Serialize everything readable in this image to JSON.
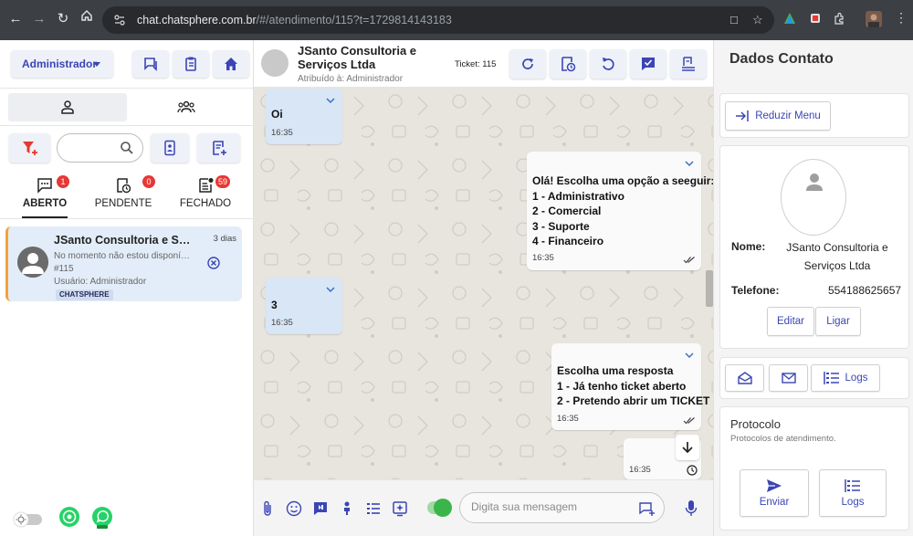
{
  "browser": {
    "url_host": "chat.chatsphere.com.br",
    "url_path": "/#/atendimento/115?t=1729814143183"
  },
  "left": {
    "role_label": "Administrador",
    "status_tabs": [
      {
        "label": "ABERTO",
        "badge": "1"
      },
      {
        "label": "PENDENTE",
        "badge": "0"
      },
      {
        "label": "FECHADO",
        "badge": "59"
      }
    ],
    "ticket": {
      "name": "JSanto Consultoria e Ser...",
      "time": "3 dias",
      "last_message": "No momento não estou disponív...",
      "number": "#115",
      "user": "Usuário: Administrador",
      "tag": "CHATSPHERE"
    }
  },
  "chat": {
    "title": "JSanto Consultoria e Serviços Ltda",
    "assigned": "Atribuído à: Administrador",
    "ticket_label": "Ticket: 115",
    "messages": [
      {
        "dir": "in",
        "text": "Oi",
        "time": "16:35"
      },
      {
        "dir": "out",
        "text": "Olá! Escolha uma opção a seeguir:\n1 - Administrativo\n2 - Comercial\n3 - Suporte\n4 - Financeiro",
        "time": "16:35"
      },
      {
        "dir": "in",
        "text": "3",
        "time": "16:35"
      },
      {
        "dir": "out",
        "text": "Escolha uma resposta\n1 - Já tenho ticket aberto\n2 - Pretendo abrir um TICKET",
        "time": "16:35"
      },
      {
        "dir": "out",
        "text": "",
        "time": "16:35"
      }
    ],
    "input_placeholder": "Digita sua mensagem"
  },
  "contact": {
    "title": "Dados Contato",
    "reduce_menu": "Reduzir Menu",
    "name_label": "Nome:",
    "name_value": "JSanto Consultoria e Serviços Ltda",
    "phone_label": "Telefone:",
    "phone_value": "554188625657",
    "edit_label": "Editar",
    "call_label": "Ligar",
    "logs_label": "Logs",
    "protocol_title": "Protocolo",
    "protocol_sub": "Protocolos de atendimento.",
    "send_label": "Enviar",
    "logs2_label": "Logs"
  },
  "colors": {
    "accent": "#3b45b4",
    "badge": "#e53935",
    "ticket_bg": "#e3edf9",
    "incoming_bubble": "#d8e6f6",
    "whatsapp_green": "#25d366"
  }
}
